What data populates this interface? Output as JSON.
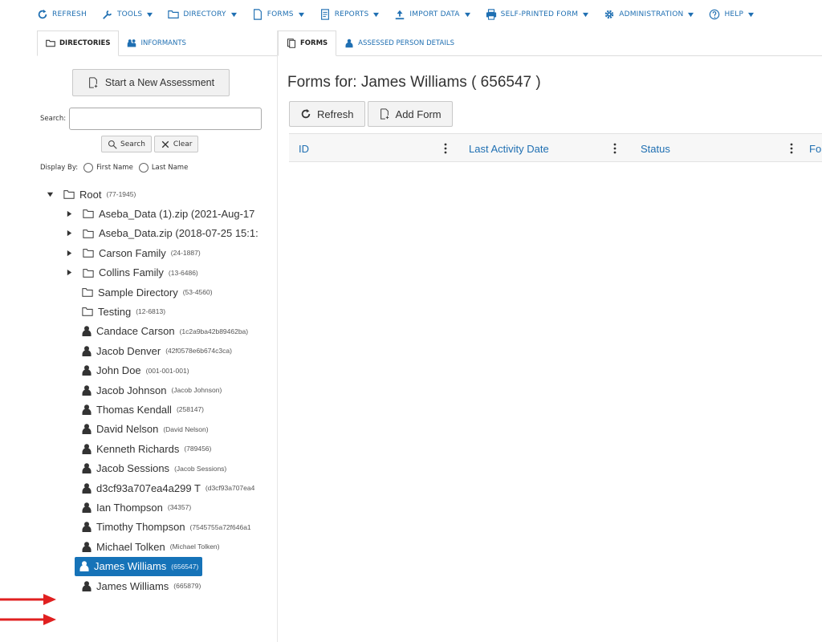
{
  "toolbar": {
    "items": [
      {
        "label": "Refresh",
        "icon": "refresh-icon",
        "dropdown": false
      },
      {
        "label": "Tools",
        "icon": "wrench-icon",
        "dropdown": true
      },
      {
        "label": "Directory",
        "icon": "folder-icon",
        "dropdown": true
      },
      {
        "label": "Forms",
        "icon": "document-icon",
        "dropdown": true
      },
      {
        "label": "Reports",
        "icon": "report-icon",
        "dropdown": true
      },
      {
        "label": "Import Data",
        "icon": "upload-icon",
        "dropdown": true
      },
      {
        "label": "Self-Printed Form",
        "icon": "printer-icon",
        "dropdown": true
      },
      {
        "label": "Administration",
        "icon": "gear-icon",
        "dropdown": true
      },
      {
        "label": "Help",
        "icon": "help-icon",
        "dropdown": true
      }
    ]
  },
  "left": {
    "tabs": [
      {
        "label": "Directories",
        "active": true
      },
      {
        "label": "Informants",
        "active": false
      }
    ],
    "start_button": "Start a New Assessment",
    "search_label": "Search:",
    "search_value": "",
    "search_button": "Search",
    "clear_button": "Clear",
    "display_by_label": "Display By:",
    "display_first": "First Name",
    "display_last": "Last Name",
    "tree": [
      {
        "type": "folder",
        "name": "Root",
        "sub": "(77-1945)",
        "toggle": "expanded",
        "level": 0
      },
      {
        "type": "folder",
        "name": "Aseba_Data (1).zip (2021-Aug-17",
        "sub": "",
        "toggle": "collapsed",
        "level": 1
      },
      {
        "type": "folder",
        "name": "Aseba_Data.zip (2018-07-25 15:1:",
        "sub": "",
        "toggle": "collapsed",
        "level": 1
      },
      {
        "type": "folder",
        "name": "Carson Family",
        "sub": "(24-1887)",
        "toggle": "collapsed",
        "level": 1
      },
      {
        "type": "folder",
        "name": "Collins Family",
        "sub": "(13-6486)",
        "toggle": "collapsed",
        "level": 1
      },
      {
        "type": "folder",
        "name": "Sample Directory",
        "sub": "(53-4560)",
        "toggle": "none",
        "level": 1
      },
      {
        "type": "folder",
        "name": "Testing",
        "sub": "(12-6813)",
        "toggle": "none",
        "level": 1
      },
      {
        "type": "person",
        "name": "Candace Carson",
        "sub": "(1c2a9ba42b89462ba)",
        "level": 1
      },
      {
        "type": "person",
        "name": "Jacob Denver",
        "sub": "(42f0578e6b674c3ca)",
        "level": 1
      },
      {
        "type": "person",
        "name": "John Doe",
        "sub": "(001-001-001)",
        "level": 1
      },
      {
        "type": "person",
        "name": "Jacob Johnson",
        "sub": "(Jacob Johnson)",
        "level": 1
      },
      {
        "type": "person",
        "name": "Thomas Kendall",
        "sub": "(258147)",
        "level": 1
      },
      {
        "type": "person",
        "name": "David Nelson",
        "sub": "(David Nelson)",
        "level": 1
      },
      {
        "type": "person",
        "name": "Kenneth Richards",
        "sub": "(789456)",
        "level": 1
      },
      {
        "type": "person",
        "name": "Jacob Sessions",
        "sub": "(Jacob Sessions)",
        "level": 1
      },
      {
        "type": "person",
        "name": "d3cf93a707ea4a299 T",
        "sub": "(d3cf93a707ea4",
        "level": 1
      },
      {
        "type": "person",
        "name": "Ian Thompson",
        "sub": "(34357)",
        "level": 1
      },
      {
        "type": "person",
        "name": "Timothy Thompson",
        "sub": "(7545755a72f646a1",
        "level": 1
      },
      {
        "type": "person",
        "name": "Michael Tolken",
        "sub": "(Michael Tolken)",
        "level": 1
      },
      {
        "type": "person",
        "name": "James Williams",
        "sub": "(656547)",
        "level": 1,
        "selected": true
      },
      {
        "type": "person",
        "name": "James Williams",
        "sub": "(665879)",
        "level": 1
      }
    ]
  },
  "right": {
    "tabs": [
      {
        "label": "Forms",
        "active": true
      },
      {
        "label": "Assessed Person Details",
        "active": false
      }
    ],
    "title_prefix": "Forms for:",
    "title_name": "James Williams",
    "title_id": "( 656547 )",
    "refresh_button": "Refresh",
    "add_form_button": "Add Form",
    "columns": [
      "ID",
      "Last Activity Date",
      "Status",
      "For"
    ]
  },
  "colors": {
    "accent": "#1f6fb2",
    "selected_bg": "#1673b8",
    "arrow": "#e02020"
  }
}
